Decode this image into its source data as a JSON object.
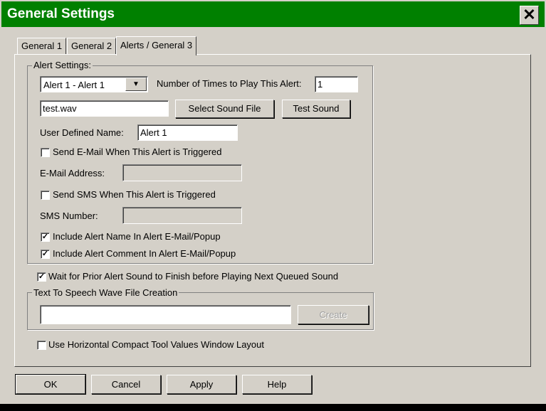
{
  "window": {
    "title": "General Settings",
    "close_glyph": "✕"
  },
  "tabs": [
    {
      "label": "General 1"
    },
    {
      "label": "General 2"
    },
    {
      "label": "Alerts / General 3"
    }
  ],
  "alert_settings": {
    "legend": "Alert Settings:",
    "alert_select_value": "Alert 1 - Alert 1",
    "times_label": "Number of Times to Play This Alert:",
    "times_value": "1",
    "sound_file_value": "test.wav",
    "select_sound_label": "Select Sound File",
    "test_sound_label": "Test Sound",
    "user_defined_name_label": "User Defined Name:",
    "user_defined_name_value": "Alert 1",
    "send_email_label": "Send E-Mail When This Alert is Triggered",
    "send_email_checked": false,
    "email_address_label": "E-Mail Address:",
    "email_address_value": "",
    "send_sms_label": "Send SMS When This Alert is Triggered",
    "send_sms_checked": false,
    "sms_number_label": "SMS Number:",
    "sms_number_value": "",
    "include_name_label": "Include Alert Name In Alert E-Mail/Popup",
    "include_name_checked": true,
    "include_comment_label": "Include Alert Comment In Alert E-Mail/Popup",
    "include_comment_checked": true
  },
  "wait_prior_label": "Wait for Prior Alert Sound to Finish before Playing Next Queued Sound",
  "wait_prior_checked": true,
  "tts": {
    "legend": "Text To Speech Wave File Creation",
    "input_value": "",
    "create_label": "Create"
  },
  "horizontal_layout_label": "Use Horizontal Compact Tool Values Window Layout",
  "horizontal_layout_checked": false,
  "footer": {
    "ok_label": "OK",
    "cancel_label": "Cancel",
    "apply_label": "Apply",
    "help_label": "Help"
  },
  "check_glyph": "✓",
  "dropdown_glyph": "▼",
  "colors": {
    "titlebar": "#008000",
    "dialog_face": "#d4d0c8"
  }
}
